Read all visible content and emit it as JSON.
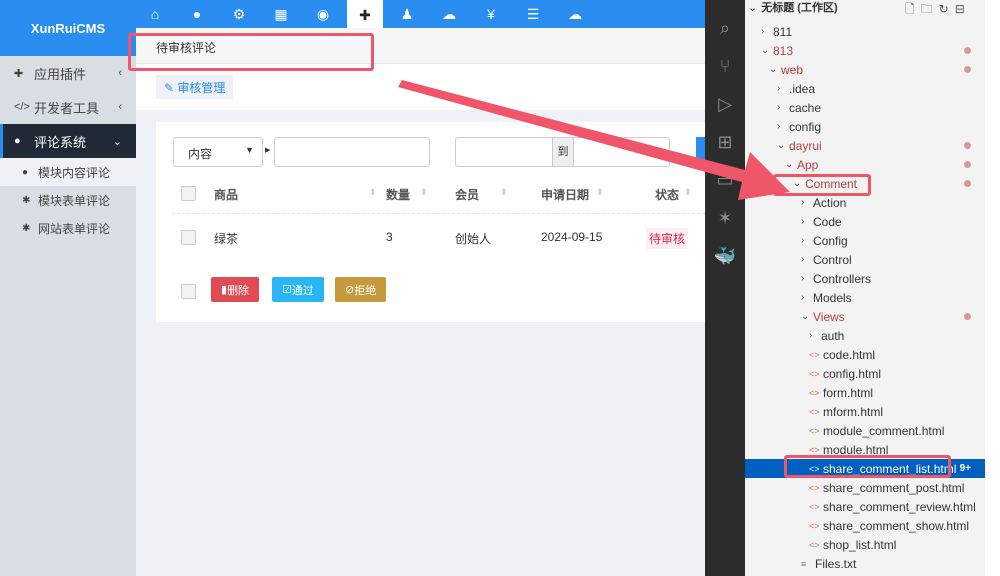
{
  "app": {
    "logo": "XunRuiCMS"
  },
  "topnav": {
    "icons": [
      "home-icon",
      "globe-icon",
      "cogs-icon",
      "grid-icon",
      "user-circle-icon",
      "puzzle-icon",
      "user-icon",
      "wechat-icon",
      "yen-icon",
      "list-icon",
      "cloud-icon"
    ],
    "glyphs": [
      "⌂",
      "●",
      "⚙",
      "▦",
      "◉",
      "✚",
      "♟",
      "☁",
      "¥",
      "☰",
      "☁"
    ],
    "active_index": 5
  },
  "sidebar": {
    "items": [
      {
        "label": "应用插件",
        "icon": "puzzle-icon"
      },
      {
        "label": "开发者工具",
        "icon": "code-icon"
      },
      {
        "label": "评论系统",
        "icon": "comments-icon",
        "active": true
      }
    ],
    "sub": [
      {
        "label": "模块内容评论",
        "icon": "comments-icon",
        "active": true
      },
      {
        "label": "模块表单评论",
        "icon": "gear-icon"
      },
      {
        "label": "网站表单评论",
        "icon": "gear-icon"
      }
    ]
  },
  "breadcrumb": "待审核评论",
  "tab": "审核管理",
  "filter": {
    "field_select": "内容",
    "keyword": "",
    "date_from": "",
    "date_sep": "到",
    "date_to": ""
  },
  "table": {
    "headers": [
      "商品",
      "数量",
      "会员",
      "申请日期",
      "状态"
    ],
    "rows": [
      {
        "product": "绿茶",
        "qty": "3",
        "member": "创始人",
        "date": "2024-09-15",
        "status": "待审核"
      }
    ]
  },
  "actions": {
    "delete": "删除",
    "approve": "通过",
    "reject": "拒绝",
    "colors": {
      "delete": "#e04b54",
      "approve": "#29b6f6",
      "reject": "#c49a3c"
    }
  },
  "explorer": {
    "title": "无标题 (工作区)",
    "items": [
      {
        "label": "811",
        "depth": 0,
        "type": "folder",
        "open": false
      },
      {
        "label": "813",
        "depth": 0,
        "type": "folder",
        "open": true,
        "mod": true
      },
      {
        "label": "web",
        "depth": 1,
        "type": "folder",
        "open": true,
        "mod": true
      },
      {
        "label": ".idea",
        "depth": 2,
        "type": "folder",
        "open": false
      },
      {
        "label": "cache",
        "depth": 2,
        "type": "folder",
        "open": false
      },
      {
        "label": "config",
        "depth": 2,
        "type": "folder",
        "open": false
      },
      {
        "label": "dayrui",
        "depth": 2,
        "type": "folder",
        "open": true,
        "mod": true
      },
      {
        "label": "App",
        "depth": 3,
        "type": "folder",
        "open": true,
        "mod": true
      },
      {
        "label": "Comment",
        "depth": 4,
        "type": "folder",
        "open": true,
        "mod": true
      },
      {
        "label": "Action",
        "depth": 5,
        "type": "folder",
        "open": false
      },
      {
        "label": "Code",
        "depth": 5,
        "type": "folder",
        "open": false
      },
      {
        "label": "Config",
        "depth": 5,
        "type": "folder",
        "open": false
      },
      {
        "label": "Control",
        "depth": 5,
        "type": "folder",
        "open": false
      },
      {
        "label": "Controllers",
        "depth": 5,
        "type": "folder",
        "open": false
      },
      {
        "label": "Models",
        "depth": 5,
        "type": "folder",
        "open": false
      },
      {
        "label": "Views",
        "depth": 5,
        "type": "folder",
        "open": true,
        "mod": true
      },
      {
        "label": "auth",
        "depth": 6,
        "type": "folder",
        "open": false
      },
      {
        "label": "code.html",
        "depth": 6,
        "type": "html"
      },
      {
        "label": "config.html",
        "depth": 6,
        "type": "html"
      },
      {
        "label": "form.html",
        "depth": 6,
        "type": "html"
      },
      {
        "label": "mform.html",
        "depth": 6,
        "type": "html"
      },
      {
        "label": "module_comment.html",
        "depth": 6,
        "type": "html"
      },
      {
        "label": "module.html",
        "depth": 6,
        "type": "html"
      },
      {
        "label": "share_comment_list.html",
        "depth": 6,
        "type": "html",
        "selected": true,
        "badge": "9+"
      },
      {
        "label": "share_comment_post.html",
        "depth": 6,
        "type": "html"
      },
      {
        "label": "share_comment_review.html",
        "depth": 6,
        "type": "html"
      },
      {
        "label": "share_comment_show.html",
        "depth": 6,
        "type": "html"
      },
      {
        "label": "shop_list.html",
        "depth": 6,
        "type": "html"
      },
      {
        "label": "Files.txt",
        "depth": 5,
        "type": "txt"
      }
    ]
  },
  "activity_bar": [
    "search-icon",
    "source-control-icon",
    "run-debug-icon",
    "extensions-icon",
    "remote-explorer-icon",
    "kubernetes-icon",
    "docker-icon"
  ],
  "annotation_color": "#f0566a"
}
